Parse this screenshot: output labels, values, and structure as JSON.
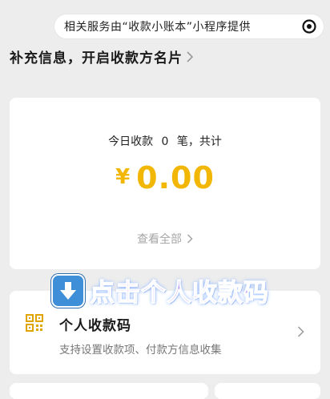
{
  "top_bar": {
    "text": "相关服务由“收款小账本”小程序提供",
    "icon": "target-icon"
  },
  "heading": {
    "text": "补充信息，开启收款方名片",
    "icon": "chevron-right-icon"
  },
  "summary": {
    "today_label": "今日收款",
    "count": "0",
    "count_unit": "笔，共计",
    "currency": "¥",
    "amount": "0.00",
    "view_all": "查看全部"
  },
  "overlay": {
    "icon": "arrow-down-icon",
    "text": "点击个人收款码"
  },
  "qr_entry": {
    "icon": "qr-code-icon",
    "title": "个人收款码",
    "subtitle": "支持设置收款项、付款方信息收集"
  },
  "colors": {
    "background": "#ededed",
    "amount": "#f2b705",
    "qr_icon": "#e0a500",
    "overlay_arrow_bg": "#3f8fd8",
    "overlay_text": "#b89df2"
  }
}
